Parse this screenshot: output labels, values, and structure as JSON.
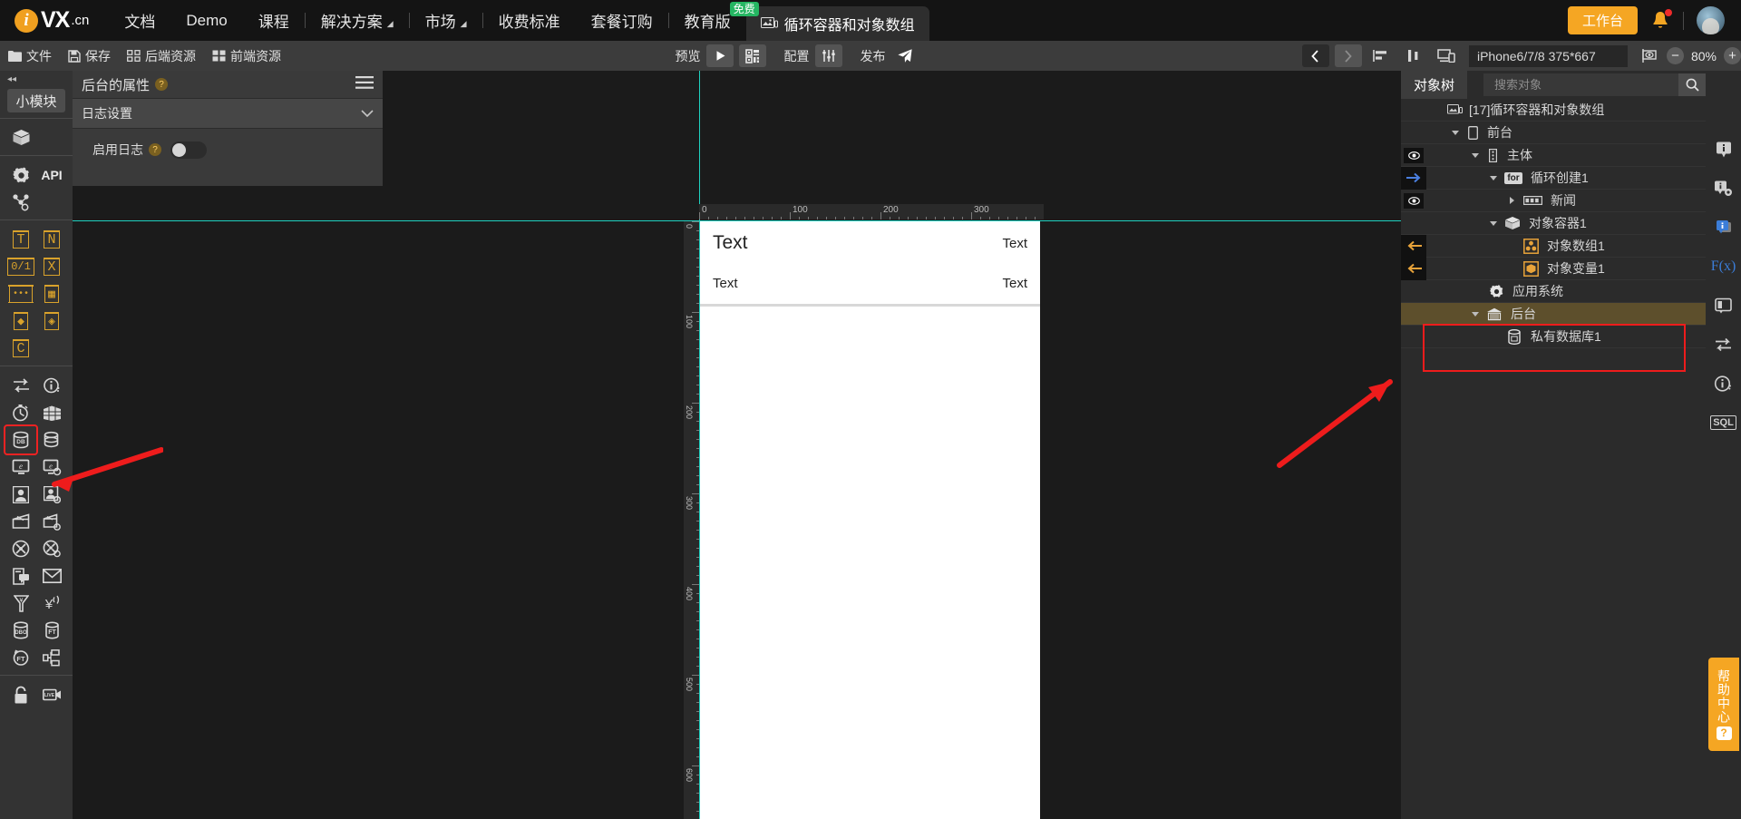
{
  "topnav": {
    "brand": {
      "mark": "i",
      "name": "VX",
      "suffix": ".cn"
    },
    "items": [
      {
        "label": "文档",
        "caret": false
      },
      {
        "label": "Demo",
        "caret": false
      },
      {
        "label": "课程",
        "caret": false
      },
      {
        "label": "解决方案",
        "caret": true
      },
      {
        "label": "市场",
        "caret": true
      },
      {
        "label": "收费标准",
        "caret": false
      },
      {
        "label": "套餐订购",
        "caret": false
      },
      {
        "label": "教育版",
        "caret": false,
        "badge": "免费"
      }
    ],
    "active_tab": "循环容器和对象数组",
    "workbench": "工作台"
  },
  "toolbar": {
    "left": [
      {
        "label": "文件",
        "icon": "folder-icon"
      },
      {
        "label": "保存",
        "icon": "save-icon"
      },
      {
        "label": "后端资源",
        "icon": "backend-resource-icon"
      },
      {
        "label": "前端资源",
        "icon": "frontend-resource-icon"
      }
    ],
    "preview_label": "预览",
    "config_label": "配置",
    "publish_label": "发布",
    "device": "iPhone6/7/8 375*667",
    "zoom": "80%",
    "zoom_out": "−",
    "zoom_in": "+"
  },
  "rail": {
    "collapse": "◂◂",
    "title": "小模块",
    "api_label": "API",
    "groups": [
      {
        "name": "component-group",
        "cells": [
          {
            "icon": "package-icon"
          }
        ]
      },
      {
        "name": "api-group",
        "cells": [
          {
            "icon": "gear-icon"
          },
          {
            "icon": "api-text",
            "text": "API"
          },
          {
            "icon": "flow-node-icon"
          }
        ]
      },
      {
        "name": "variable-group",
        "cells": [
          {
            "icon": "text-variable-icon",
            "text": "T"
          },
          {
            "icon": "number-variable-icon",
            "text": "N"
          },
          {
            "icon": "percent-variable-icon",
            "text": "0/1"
          },
          {
            "icon": "x-variable-icon",
            "text": "X"
          },
          {
            "icon": "array-variable-icon",
            "text": "•••"
          },
          {
            "icon": "table-variable-icon",
            "text": "▦"
          },
          {
            "icon": "object-variable-icon",
            "text": "◆"
          },
          {
            "icon": "object-array-icon",
            "text": "◈"
          },
          {
            "icon": "clock-variable-icon",
            "text": "C"
          }
        ]
      },
      {
        "name": "service-group",
        "cells": [
          {
            "icon": "transfer-icon"
          },
          {
            "icon": "info-clock-icon"
          },
          {
            "icon": "timer-icon"
          },
          {
            "icon": "grid-table-icon"
          },
          {
            "icon": "database-icon"
          },
          {
            "icon": "database-cloud-icon"
          },
          {
            "icon": "e-monitor-icon"
          },
          {
            "icon": "e-monitor-cloud-icon"
          },
          {
            "icon": "user-icon"
          },
          {
            "icon": "user-copy-icon"
          },
          {
            "icon": "wallet-icon"
          },
          {
            "icon": "wallet-cloud-icon"
          },
          {
            "icon": "fan-icon"
          },
          {
            "icon": "fan-cloud-icon"
          },
          {
            "icon": "form-chat-icon"
          },
          {
            "icon": "mail-icon"
          },
          {
            "icon": "yuan-funnel-icon"
          },
          {
            "icon": "yuan-signal-icon"
          },
          {
            "icon": "dbo-icon"
          },
          {
            "icon": "ft-icon"
          },
          {
            "icon": "ft-refresh-icon"
          },
          {
            "icon": "flowchart-icon"
          }
        ]
      },
      {
        "name": "security-group",
        "cells": [
          {
            "icon": "lock-icon"
          },
          {
            "icon": "live-camera-icon"
          }
        ]
      }
    ]
  },
  "props": {
    "title": "后台的属性",
    "section": "日志设置",
    "row_label": "启用日志",
    "toggle_on": false
  },
  "canvas": {
    "ruler_h_labels": [
      "0",
      "100",
      "200",
      "300"
    ],
    "ruler_v_labels": [
      "0",
      "100",
      "200",
      "300",
      "400",
      "500",
      "600"
    ],
    "phone_rows": [
      {
        "left": "Text",
        "right": "Text"
      },
      {
        "left": "Text",
        "right": "Text"
      }
    ]
  },
  "tree": {
    "tab": "对象树",
    "search_placeholder": "搜索对象",
    "nodes": [
      {
        "label": "[17]循环容器和对象数组",
        "icon": "app-icon",
        "indent": 0,
        "gutter": "none",
        "toggle": "none",
        "selected": false
      },
      {
        "label": "前台",
        "icon": "phone-icon",
        "indent": 1,
        "gutter": "none",
        "toggle": "down",
        "selected": false
      },
      {
        "label": "主体",
        "icon": "page-icon",
        "indent": 2,
        "gutter": "eye",
        "toggle": "down",
        "selected": false
      },
      {
        "label": "循环创建1",
        "icon": "for-tag",
        "indent": 3,
        "gutter": "arrow",
        "toggle": "down",
        "selected": false
      },
      {
        "label": "新闻",
        "icon": "component-icon",
        "indent": 4,
        "gutter": "eye",
        "toggle": "right",
        "selected": false
      },
      {
        "label": "对象容器1",
        "icon": "box-icon",
        "indent": 3,
        "gutter": "none",
        "toggle": "down",
        "selected": false
      },
      {
        "label": "对象数组1",
        "icon": "object-array-icon",
        "indent": 4,
        "gutter": "arrow-left",
        "toggle": "none",
        "selected": false
      },
      {
        "label": "对象变量1",
        "icon": "object-variable-icon",
        "indent": 4,
        "gutter": "arrow-left",
        "toggle": "none",
        "selected": false
      },
      {
        "label": "应用系统",
        "icon": "gear-icon",
        "indent": 2,
        "gutter": "none",
        "toggle": "none",
        "selected": false
      },
      {
        "label": "后台",
        "icon": "server-icon",
        "indent": 2,
        "gutter": "none",
        "toggle": "down",
        "selected": true
      },
      {
        "label": "私有数据库1",
        "icon": "database-icon",
        "indent": 3,
        "gutter": "none",
        "toggle": "none",
        "selected": false
      }
    ]
  },
  "rrail": {
    "icons": [
      {
        "name": "info-icon"
      },
      {
        "name": "info-gear-icon"
      },
      {
        "name": "info-stack-icon",
        "accent": "#3b7dd8"
      },
      {
        "name": "fx-icon",
        "text": "F(x)",
        "accent": "#3b7dd8"
      },
      {
        "name": "panel-icon"
      },
      {
        "name": "exchange-icon"
      },
      {
        "name": "info-circle-icon"
      },
      {
        "name": "sql-icon",
        "text": "SQL"
      }
    ],
    "help": {
      "text": "帮助中心",
      "mark": "?"
    }
  },
  "colors": {
    "accent_orange": "#f5a623",
    "accent_green": "#25b662",
    "annotation_red": "#ee1c1c",
    "guide_cyan": "#1fd0c0",
    "selection": "#5d4f2c",
    "icon_gold": "#d9a22b"
  }
}
